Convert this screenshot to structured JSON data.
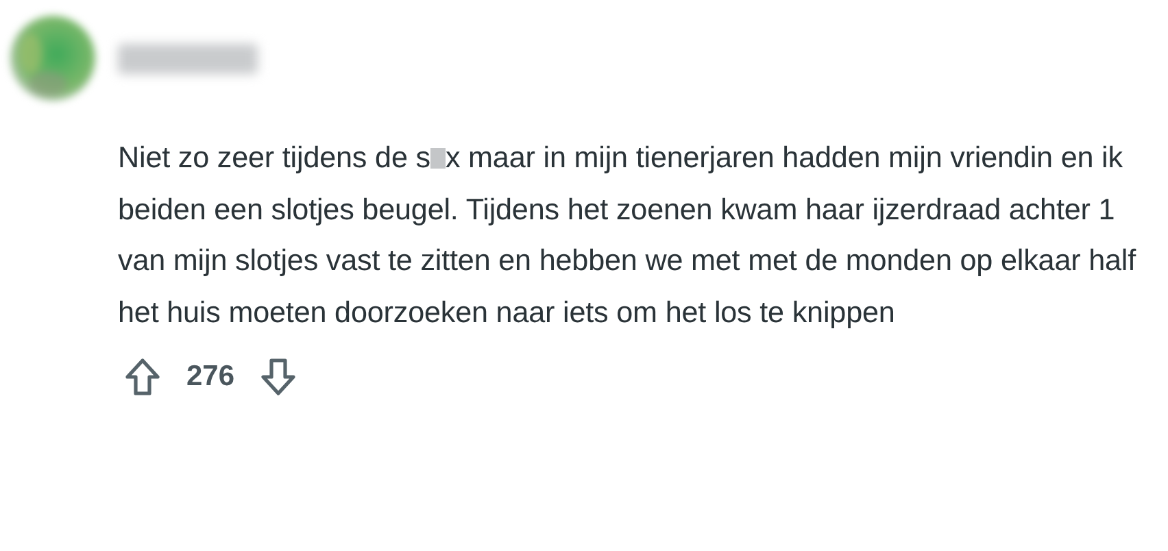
{
  "comment": {
    "body": [
      {
        "kind": "text",
        "text": "Niet zo zeer tijdens de s"
      },
      {
        "kind": "censor"
      },
      {
        "kind": "text",
        "text": "x maar in mijn tienerjaren hadden mijn vriendin en ik beiden een slotjes beugel. Tijdens het zoenen kwam haar ijzerdraad achter 1 van mijn slotjes vast te zitten en hebben we met met de monden op elkaar half het huis moeten doorzoeken naar iets om het los te knippen"
      }
    ],
    "score": "276"
  }
}
